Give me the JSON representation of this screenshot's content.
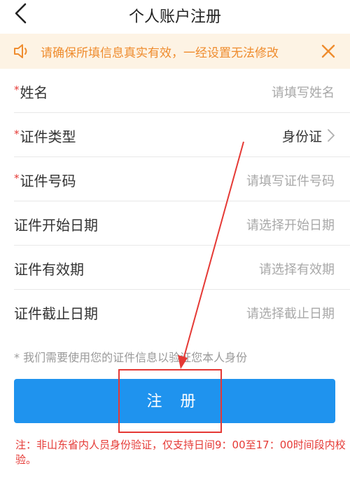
{
  "navbar": {
    "title": "个人账户注册",
    "back_icon": "chevron-left-icon"
  },
  "notice": {
    "text": "请确保所填信息真实有效，一经设置无法修改",
    "color": "#ef8c2e",
    "background": "#fdf3e4"
  },
  "form": {
    "required_mark": "*",
    "rows": [
      {
        "label": "姓名",
        "required": true,
        "value": "",
        "placeholder": "请填写姓名"
      },
      {
        "label": "证件类型",
        "required": true,
        "value": "身份证",
        "placeholder": ""
      },
      {
        "label": "证件号码",
        "required": true,
        "value": "",
        "placeholder": "请填写证件号码"
      },
      {
        "label": "证件开始日期",
        "required": false,
        "value": "",
        "placeholder": "请选择开始日期"
      },
      {
        "label": "证件有效期",
        "required": false,
        "value": "",
        "placeholder": "请选择有效期"
      },
      {
        "label": "证件截止日期",
        "required": false,
        "value": "",
        "placeholder": "请选择截止日期"
      }
    ]
  },
  "hint": "* 我们需要使用您的证件信息以验证您本人身份",
  "register_button": {
    "label": "注 册",
    "color": "#1f93ee"
  },
  "footnote": "注：非山东省内人员身份验证，仅支持日间9：00至17：00时间段内校验。",
  "annotation_color": "#e53935"
}
